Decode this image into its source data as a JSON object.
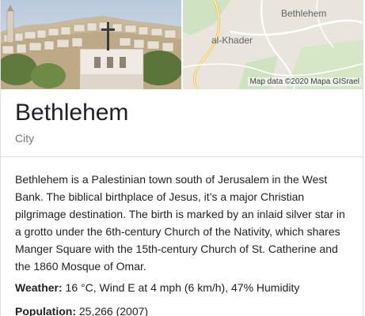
{
  "entity": {
    "title": "Bethlehem",
    "subtitle": "City"
  },
  "map": {
    "labels": {
      "bethlehem": "Bethlehem",
      "al_khader": "al-Khader"
    },
    "credit": "Map data ©2020 Mapa GISrael"
  },
  "description": "Bethlehem is a Palestinian town south of Jerusalem in the West Bank. The biblical birthplace of Jesus, it’s a major Christian pilgrimage destination. The birth is marked by an inlaid silver star in a grotto under the 6th-century Church of the Nativity, which shares Manger Square with the 15th-century Church of St. Catherine and the 1860 Mosque of Omar.",
  "facts": {
    "weather": {
      "label": "Weather:",
      "value": "16 °C, Wind E at 4 mph (6 km/h), 47% Humidity"
    },
    "population": {
      "label": "Population:",
      "value": "25,266 (2007)"
    }
  },
  "colors": {
    "title": "#202124",
    "subtitle": "#70757a",
    "text": "#222222",
    "divider": "#dfe1e5",
    "map_land": "#e9e5dc",
    "map_green": "#cfe3c2",
    "map_road": "#f4c542"
  }
}
